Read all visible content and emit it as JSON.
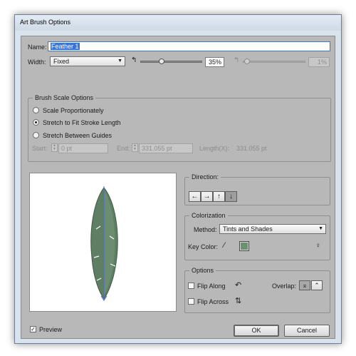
{
  "window": {
    "title": "Art Brush Options"
  },
  "name": {
    "label": "Name:",
    "value": "Feather 1"
  },
  "width": {
    "label": "Width:",
    "select_value": "Fixed",
    "slider_percent": "35%",
    "slider_level": 0.35,
    "max_percent": "1%",
    "max_level": 0.01
  },
  "brush_scale": {
    "title": "Brush Scale Options",
    "options": [
      "Scale Proportionately",
      "Stretch to Fit Stroke Length",
      "Stretch Between Guides"
    ],
    "selected_index": 1,
    "start_label": "Start:",
    "start_value": "0 pt",
    "end_label": "End:",
    "end_value": "331.055 pt",
    "length_label": "Length(X):",
    "length_value": "331.055 pt"
  },
  "direction": {
    "title": "Direction:",
    "buttons": [
      "←",
      "→",
      "↑",
      "↓"
    ],
    "active_index": 3
  },
  "colorization": {
    "title": "Colorization",
    "method_label": "Method:",
    "method_value": "Tints and Shades",
    "key_color_label": "Key Color:",
    "key_color": "#6d8f74"
  },
  "options": {
    "title": "Options",
    "flip_along": "Flip Along",
    "flip_across": "Flip Across",
    "overlap_label": "Overlap:"
  },
  "footer": {
    "preview_label": "Preview",
    "preview_checked": true,
    "ok": "OK",
    "cancel": "Cancel"
  }
}
